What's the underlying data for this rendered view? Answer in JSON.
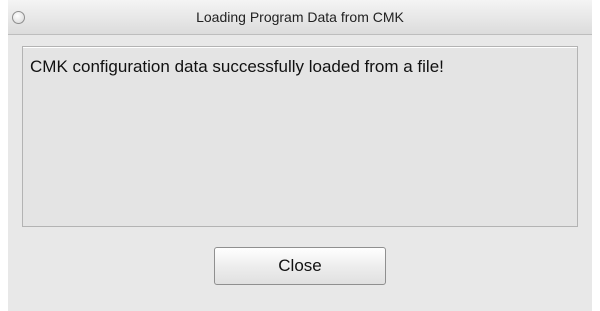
{
  "window": {
    "title": "Loading Program Data from CMK"
  },
  "message": {
    "text": "CMK configuration data successfully loaded from a file!"
  },
  "buttons": {
    "close_label": "Close"
  },
  "icons": {
    "window_close": "close-circle-icon"
  },
  "colors": {
    "window_background": "#e8e8e8",
    "message_area_background": "#e4e4e4"
  }
}
